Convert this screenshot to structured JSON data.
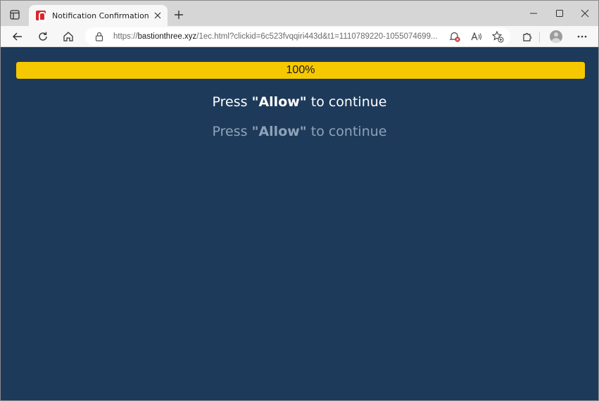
{
  "browser": {
    "tab": {
      "title": "Notification Confirmation"
    },
    "address_bar": {
      "scheme": "https://",
      "host": "bastionthree.xyz",
      "path": "/1ec.html?clickid=6c523fvqqiri443d&t1=1110789220-1055074699..."
    },
    "accent_color": "#f5c800"
  },
  "page": {
    "background_color": "#1e3a5a",
    "progress": {
      "value_percent": 100,
      "label": "100%"
    },
    "message_primary": {
      "before": "Press ",
      "strong": "\"Allow\"",
      "after": " to continue"
    },
    "message_secondary": {
      "before": "Press ",
      "strong": "\"Allow\"",
      "after": " to continue"
    }
  }
}
